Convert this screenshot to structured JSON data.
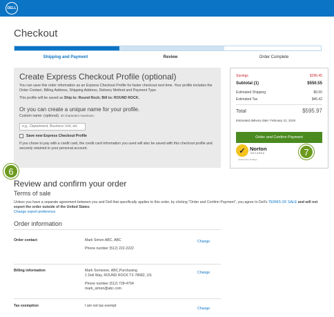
{
  "header": {
    "logo_text": "DELL"
  },
  "page": {
    "title": "Checkout"
  },
  "progress": {
    "steps": [
      "Shipping and Payment",
      "Review",
      "Order Complete"
    ],
    "check_glyph": "✓"
  },
  "express": {
    "title": "Create Express Checkout Profile (optional)",
    "description": "You can save this order information as an Express Checkout Profile for faster checkout next time. Your profile includes the Order Contact, Billing Address, Shipping Address, Delivery Method and Payment Type.",
    "ship_bill_prefix": "This profile will be saved as ",
    "ship_bill_value": "Ship to: Round Rock; Bill to: ROUND ROCK.",
    "unique_heading": "Or you can create a unique name for your profile.",
    "custom_label": "Custom name: (optional).",
    "custom_hint": "40 characters maximum.",
    "custom_placeholder": "e.g., Department, Business Unit, etc.",
    "save_label": "Save new Express Checkout Profile",
    "cc_note": "If you chose to pay with a credit card, the credit card information you used will also be saved with this checkout profile and securely retained in your personal account."
  },
  "summary": {
    "savings_label": "Savings",
    "savings_value": "$296.45",
    "subtotal_label": "Subtotal (1)",
    "subtotal_value": "$550.55",
    "shipping_label": "Estimated Shipping",
    "shipping_value": "$0.00",
    "tax_label": "Estimated Tax",
    "tax_value": "$45.42",
    "total_label": "Total",
    "total_value": "$595.97",
    "delivery": "Estimated delivery date: February 21, 2019",
    "confirm_label": "Order and Confirm Payment",
    "norton_name": "Norton",
    "norton_secured": "SECURED",
    "norton_powered": "powered by VeriSign"
  },
  "badges": {
    "b6": "6",
    "b7": "7"
  },
  "review": {
    "title": "Review and confirm your order",
    "terms_title": "Terms of sale",
    "terms_text_1": "Unless you have a separate agreement between you and Dell that specifically applies to this order, by clicking \"Order and Confirm Payment\", you agree to Dell's ",
    "terms_link": "TERMS OF SALE",
    "terms_text_2": " and will not export the order outside of the United States",
    "export_link": "Change export preference.",
    "order_info_title": "Order information",
    "change_label": "Change",
    "contact_label": "Order contact",
    "contact_name": "Mark Simon ABC,  ABC",
    "contact_phone": "Phone number (512) 222-2222",
    "billing_label": "Billing information",
    "billing_name": "Mark Someone,  ABC,Purchasing",
    "billing_addr": "1 Dell Way, ROUND ROCK TX 78682, US",
    "billing_phone": "Phone number (512) 728-4794",
    "billing_email": "mark_simon@abc.com",
    "tax_label": "Tax exemption",
    "tax_value": "I am not tax exempt"
  }
}
